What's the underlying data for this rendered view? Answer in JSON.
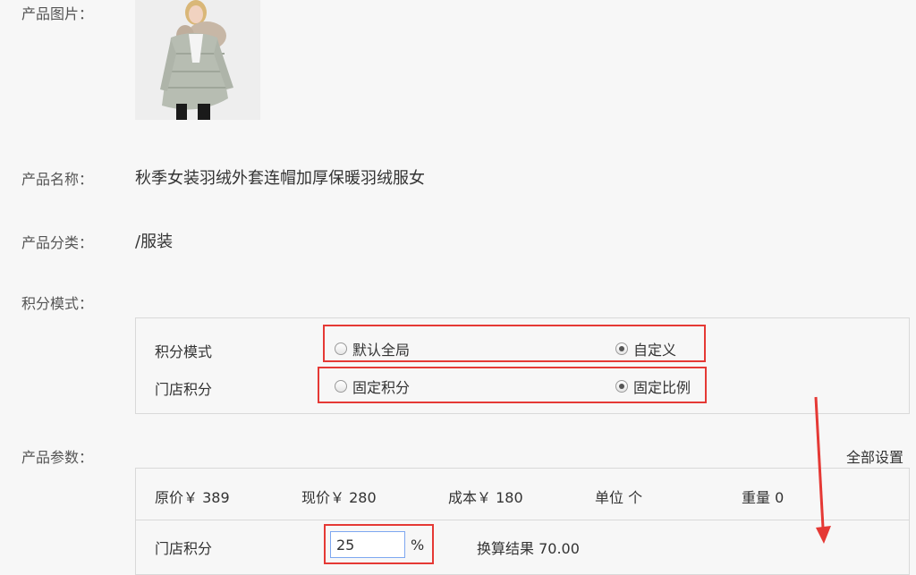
{
  "labels": {
    "image": "产品图片：",
    "name": "产品名称：",
    "category": "产品分类：",
    "points_mode": "积分模式：",
    "params": "产品参数："
  },
  "product": {
    "name": "秋季女装羽绒外套连帽加厚保暖羽绒服女",
    "category": "/服装",
    "image_alt": "woman in grey down jacket with fur hood"
  },
  "points_panel": {
    "mode_label": "积分模式",
    "mode_options": [
      {
        "label": "默认全局",
        "selected": false
      },
      {
        "label": "自定义",
        "selected": true
      }
    ],
    "store_label": "门店积分",
    "store_options": [
      {
        "label": "固定积分",
        "selected": false
      },
      {
        "label": "固定比例",
        "selected": true
      }
    ]
  },
  "params_panel": {
    "set_all": "全部设置",
    "original_price": "原价￥ 389",
    "current_price": "现价￥ 280",
    "cost": "成本￥ 180",
    "unit": "单位 个",
    "weight": "重量 0",
    "store_points_label": "门店积分",
    "store_points_value": "25",
    "percent": "%",
    "result": "换算结果 70.00"
  },
  "colors": {
    "highlight": "#e53935",
    "input_border": "#7da7f0",
    "panel_border": "#d9d9d9"
  }
}
